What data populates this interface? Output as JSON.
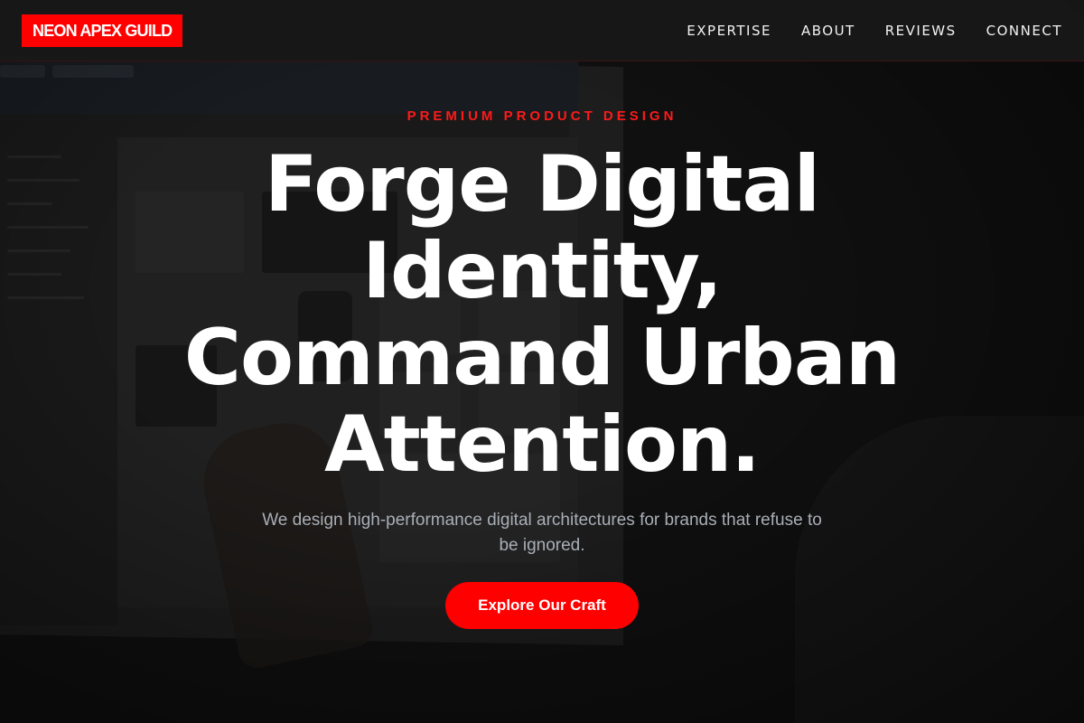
{
  "header": {
    "logo_text": "NEON APEX GUILD",
    "nav": [
      {
        "label": "EXPERTISE"
      },
      {
        "label": "ABOUT"
      },
      {
        "label": "REVIEWS"
      },
      {
        "label": "CONNECT"
      }
    ]
  },
  "hero": {
    "eyebrow": "PREMIUM PRODUCT DESIGN",
    "headline_lines": [
      "Forge Digital",
      "Identity,",
      "Command Urban",
      "Attention."
    ],
    "subheadline": "We design high-performance digital architectures for brands that refuse to be ignored.",
    "cta_label": "Explore Our Craft"
  },
  "colors": {
    "accent": "#ff0000",
    "background": "#141414",
    "text": "#ffffff",
    "muted_text": "#a9aeb6"
  }
}
